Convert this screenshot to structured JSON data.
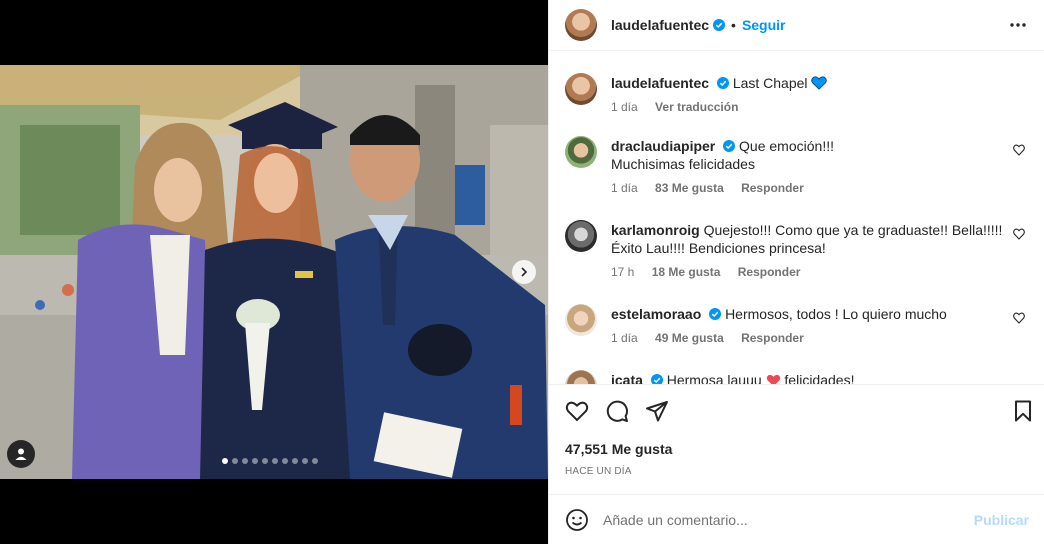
{
  "post": {
    "username": "laudelafuentec",
    "separator": "•",
    "follow_label": "Seguir",
    "caption_text": "Last Chapel",
    "caption_age": "1 día",
    "translate_label": "Ver traducción"
  },
  "comments": [
    {
      "user": "draclaudiapiper",
      "verified": true,
      "text_line1": "Que emoción!!!",
      "text_line2": "Muchisimas felicidades",
      "age": "1 día",
      "likes": "83 Me gusta",
      "reply": "Responder"
    },
    {
      "user": "karlamonroig",
      "verified": false,
      "text_line1": "Quejesto!!! Como que ya te graduaste!! Bella!!!!!",
      "text_line2": "Éxito Lau!!!! Bendiciones princesa!",
      "age": "17 h",
      "likes": "18 Me gusta",
      "reply": "Responder"
    },
    {
      "user": "estelamoraao",
      "verified": true,
      "text_line1": "Hermosos, todos ! Lo quiero mucho",
      "age": "1 día",
      "likes": "49 Me gusta",
      "reply": "Responder"
    },
    {
      "user": "icata",
      "verified": true,
      "text_line1": "Hermosa lauuu",
      "text_after_heart": "felicidades!"
    }
  ],
  "footer": {
    "likes_count": "47,551 Me gusta",
    "timestamp": "HACE UN DÍA",
    "comment_placeholder": "Añade un comentario...",
    "publish_label": "Publicar"
  },
  "carousel": {
    "total": 10,
    "active": 0
  },
  "colors": {
    "verified": "#0095f6",
    "blue_heart": "#0095f6",
    "red_heart": "#ed4956",
    "link": "#0095f6",
    "publish_disabled": "#b3dbff"
  },
  "icons": [
    "more-options-icon",
    "verified-icon",
    "blue-heart-emoji",
    "heart-icon",
    "comment-icon",
    "share-icon",
    "bookmark-icon",
    "emoji-icon",
    "chevron-right-icon",
    "user-tag-icon",
    "red-heart-emoji"
  ]
}
